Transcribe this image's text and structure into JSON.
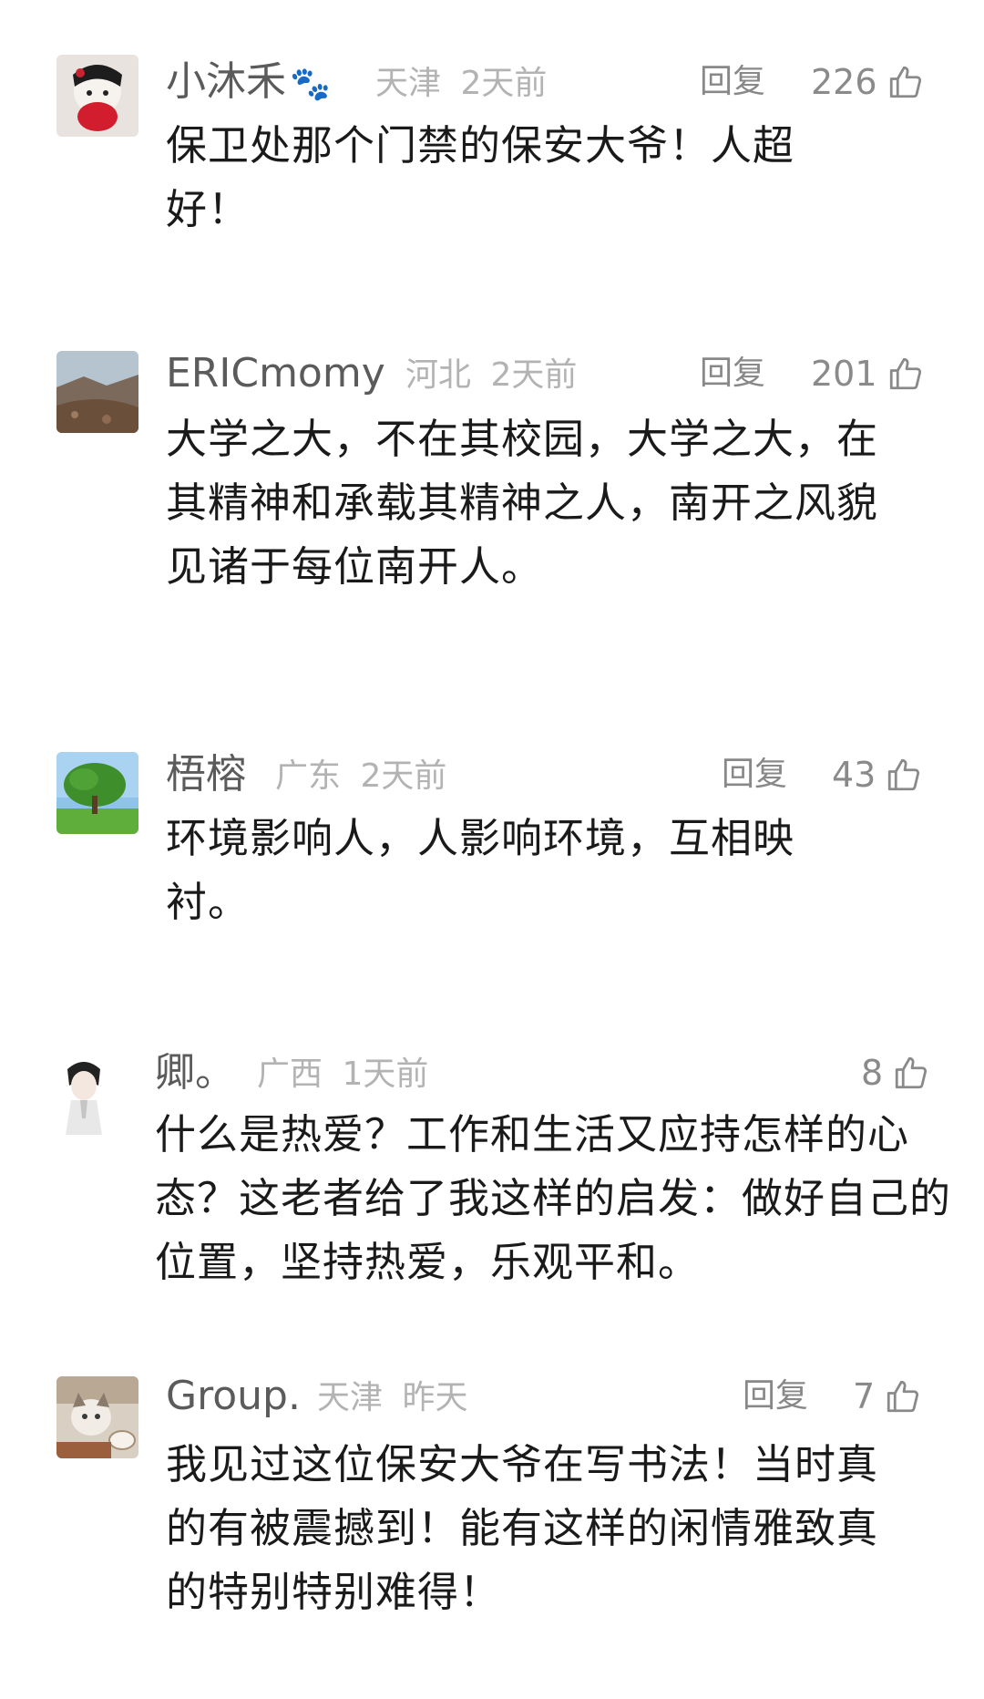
{
  "comments": [
    {
      "username": "小沐禾",
      "badge": "paw-emoji",
      "badge_glyph": "🐾",
      "region": "天津",
      "time": "2天前",
      "reply_label": "回复",
      "likes": "226",
      "text": "保卫处那个门禁的保安大爷！人超好！"
    },
    {
      "username": "ERICmomy",
      "region": "河北",
      "time": "2天前",
      "reply_label": "回复",
      "likes": "201",
      "text": "大学之大，不在其校园，大学之大，在其精神和承载其精神之人，南开之风貌见诸于每位南开人。"
    },
    {
      "username": "梧榕",
      "region": "广东",
      "time": "2天前",
      "reply_label": "回复",
      "likes": "43",
      "text": "环境影响人，人影响环境，互相映衬。"
    },
    {
      "username": "卿。",
      "region": "广西",
      "time": "1天前",
      "likes": "8",
      "text": "什么是热爱？工作和生活又应持怎样的心态？这老者给了我这样的启发：做好自己的位置，坚持热爱，乐观平和。"
    },
    {
      "username": "Group.",
      "region": "天津",
      "time": "昨天",
      "reply_label": "回复",
      "likes": "7",
      "text": "我见过这位保安大爷在写书法！当时真的有被震撼到！能有这样的闲情雅致真的特别特别难得！"
    }
  ],
  "icons": {
    "like": "thumbs-up-icon"
  },
  "colors": {
    "username": "#5b5b5b",
    "meta": "#b3b3b3",
    "reply": "#888888",
    "body": "#1a1a1a",
    "background": "#ffffff"
  }
}
